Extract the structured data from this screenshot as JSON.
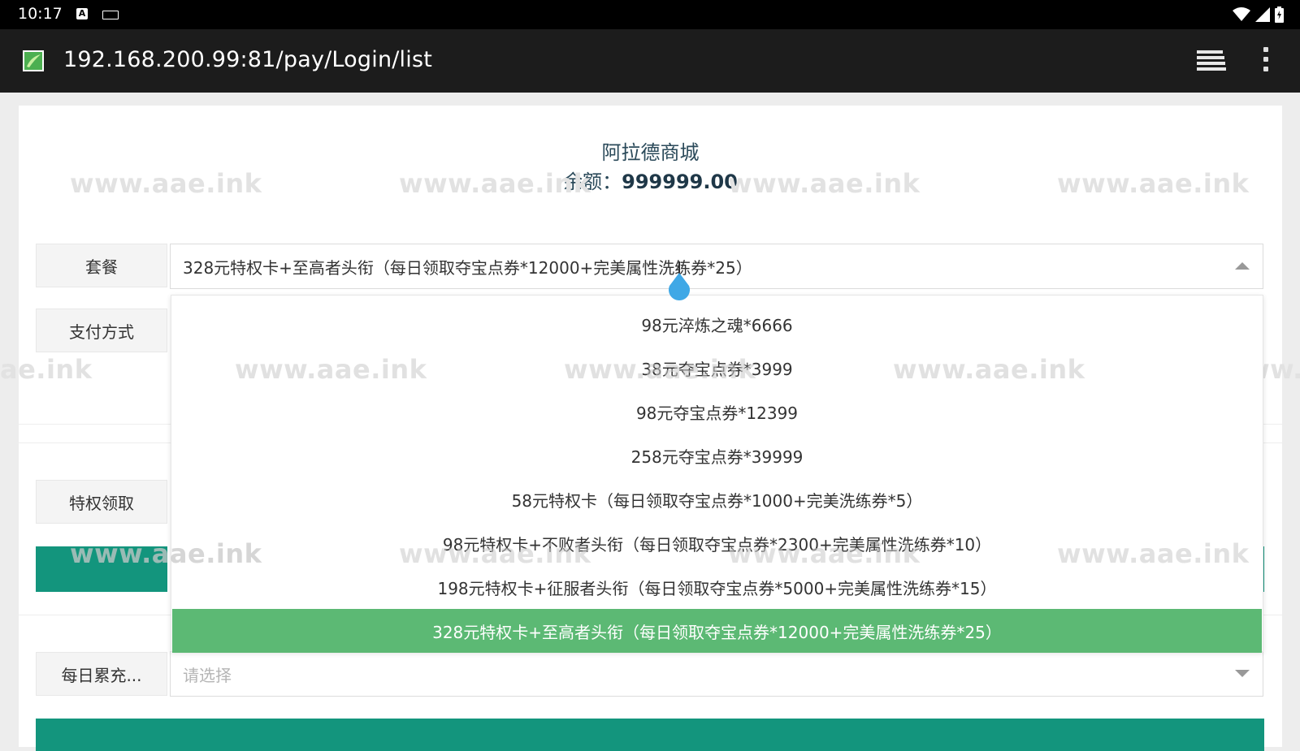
{
  "status_bar": {
    "time": "10:17",
    "icons": [
      "a-notification-icon",
      "keyboard-icon",
      "wifi-icon",
      "signal-icon",
      "battery-icon"
    ]
  },
  "browser": {
    "url": "192.168.200.99:81/pay/Login/list",
    "icons": [
      "site-favicon",
      "tabs-icon",
      "overflow-menu-icon"
    ]
  },
  "header": {
    "shop_name": "阿拉德商城",
    "balance_label": "余额：",
    "balance_value": "999999.00"
  },
  "form": {
    "package_label": "套餐",
    "package_selected": "328元特权卡+至高者头衔（每日领取夺宝点券*12000+完美属性洗练券*25）",
    "payment_label": "支付方式",
    "privilege_label": "特权领取",
    "daily_label": "每日累充...",
    "daily_placeholder": "请选择"
  },
  "dropdown": {
    "options": [
      "98元淬炼之魂*6666",
      "38元夺宝点券*3999",
      "98元夺宝点券*12399",
      "258元夺宝点券*39999",
      "58元特权卡（每日领取夺宝点券*1000+完美洗练券*5）",
      "98元特权卡+不败者头衔（每日领取夺宝点券*2300+完美属性洗练券*10）",
      "198元特权卡+征服者头衔（每日领取夺宝点券*5000+完美属性洗练券*15）",
      "328元特权卡+至高者头衔（每日领取夺宝点券*12000+完美属性洗练券*25）"
    ],
    "selected_index": 7
  },
  "watermark": {
    "text": "www.aae.ink",
    "partial_start": "ae.ink",
    "partial_end": "www.a"
  },
  "colors": {
    "teal": "#13957d",
    "selected_green": "#5cb974",
    "cursor_blue": "#3fa8e6"
  }
}
